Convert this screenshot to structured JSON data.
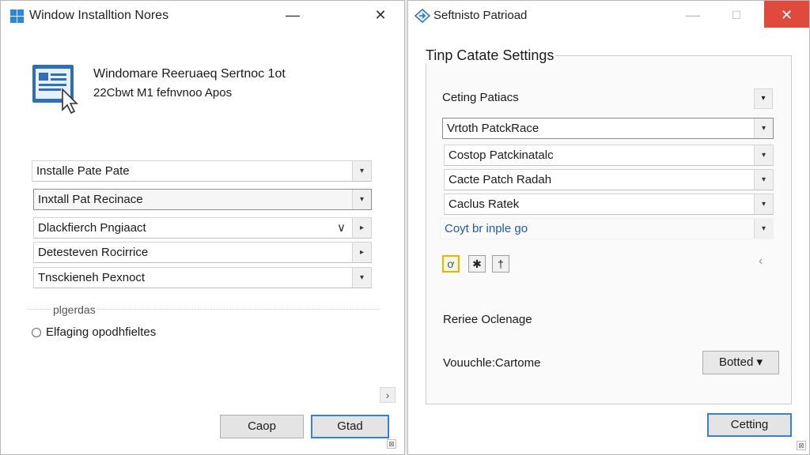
{
  "left_window": {
    "title": "Window Installtion Nores",
    "minimize_glyph": "—",
    "close_glyph": "✕",
    "app_icon": "document-cursor-icon",
    "header_line1": "Windomare Reeruaeq Sertnoc 1ot",
    "header_line2": "22Cbwt M1 fefnvnoo Apos",
    "combos": [
      {
        "text": "Installe Pate Pate",
        "arrow": "▾"
      },
      {
        "text": "Inxtall Pat Recinace",
        "arrow": "▾"
      },
      {
        "text": "Dlackfierch Pngiaact",
        "arrow": "▸",
        "chevron": "∨"
      },
      {
        "text": "Detesteven Rocirrice",
        "arrow": "▸"
      },
      {
        "text": "Tnsckieneh Pexnoct",
        "arrow": "▾"
      }
    ],
    "group_label": "plgerdas",
    "radio_label": "Elfaging opodhfieltes",
    "scroll_arrow": "›",
    "cancel_button": "Caop",
    "ok_button": "Gtad",
    "grip_glyph": "⊠"
  },
  "right_window": {
    "title": "Seftnisto Patrioad",
    "app_icon": "diamond-arrow-icon",
    "minimize_glyph": "—",
    "maximize_glyph": "☐",
    "close_glyph": "✕",
    "group_title": "Tinp Catate Settings",
    "combos": [
      {
        "text": "Ceting Patiacs",
        "arrow": "▾"
      },
      {
        "text": "Vrtoth PatckRace",
        "arrow": "▾"
      },
      {
        "text": "Costop Patckinatalc",
        "arrow": "▾"
      },
      {
        "text": "Cacte Patch Radah",
        "arrow": "▾"
      },
      {
        "text": "Caclus Ratek",
        "arrow": "▾"
      },
      {
        "text": "Coyt br inple go",
        "arrow": "▾"
      }
    ],
    "tool_buttons": [
      {
        "glyph": "ơ",
        "icon": "edit-icon"
      },
      {
        "glyph": "✱",
        "icon": "asterisk-icon"
      },
      {
        "glyph": "†",
        "icon": "dagger-icon"
      }
    ],
    "dim_arrow": "‹",
    "label1": "Reriee Oclenage",
    "label2": "Vouuchle:Cartome",
    "dropdown_button": "Botted ▾",
    "ok_button": "Cetting",
    "grip_glyph": "⊠"
  },
  "colors": {
    "accent": "#3a7fd2",
    "close_red": "#e04a3c",
    "highlight": "#e7b400",
    "link": "#1f5ba8"
  }
}
